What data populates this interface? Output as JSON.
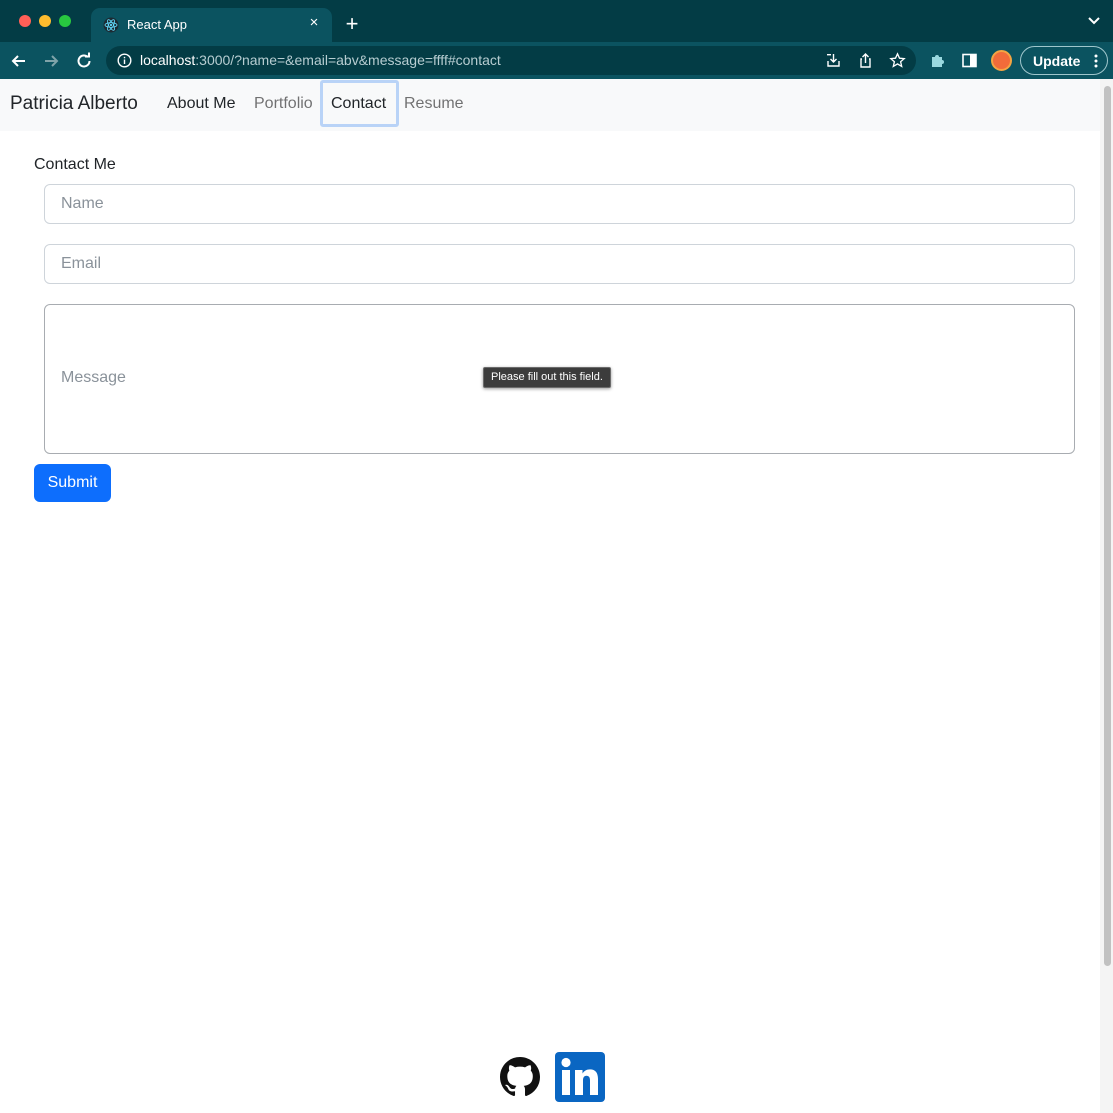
{
  "browser": {
    "tab": {
      "title": "React App",
      "favicon": "react-logo-icon",
      "close": "×"
    },
    "new_tab": "+",
    "address": {
      "host": "localhost",
      "rest": ":3000/?name=&email=abv&message=ffff#contact"
    },
    "update_label": "Update",
    "colors": {
      "frame": "#033c45",
      "toolbar": "#0b5360"
    }
  },
  "navbar": {
    "brand": "Patricia Alberto",
    "links": [
      {
        "label": "About Me"
      },
      {
        "label": "Portfolio"
      },
      {
        "label": "Contact"
      },
      {
        "label": "Resume"
      }
    ]
  },
  "contact": {
    "title": "Contact Me",
    "name_placeholder": "Name",
    "email_placeholder": "Email",
    "message_placeholder": "Message",
    "validation_tooltip": "Please fill out this field.",
    "submit_label": "Submit"
  },
  "footer": {
    "icons": [
      "github-icon",
      "linkedin-icon"
    ],
    "linkedin_color": "#0a66c2"
  }
}
